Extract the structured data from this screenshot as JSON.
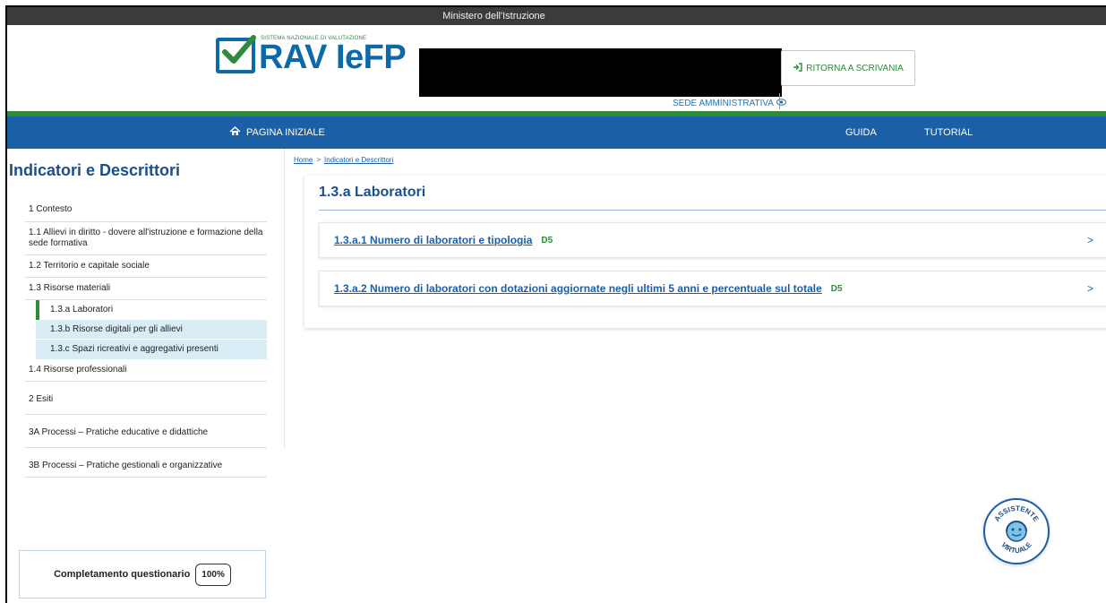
{
  "topbar": {
    "title": "Ministero dell'Istruzione"
  },
  "header": {
    "logo_sub": "SISTEMA NAZIONALE DI VALUTAZIONE",
    "logo_main": "RAV IeFP",
    "sede_label": "SEDE AMMINISTRATIVA",
    "ritorna_label": "RITORNA A SCRIVANIA"
  },
  "nav": {
    "home_label": "PAGINA INIZIALE",
    "guida_label": "GUIDA",
    "tutorial_label": "TUTORIAL"
  },
  "sidebar": {
    "title": "Indicatori e Descrittori",
    "items": [
      {
        "label": "1 Contesto"
      },
      {
        "label": "1.1 Allievi in diritto - dovere all'istruzione e formazione della sede formativa"
      },
      {
        "label": "1.2 Territorio e capitale sociale"
      },
      {
        "label": "1.3 Risorse materiali"
      }
    ],
    "subitems": [
      {
        "label": "1.3.a Laboratori",
        "active": true
      },
      {
        "label": "1.3.b Risorse digitali per gli allievi"
      },
      {
        "label": "1.3.c Spazi ricreativi e aggregativi presenti"
      }
    ],
    "items_after": [
      {
        "label": "1.4 Risorse professionali"
      },
      {
        "label": "2 Esiti"
      },
      {
        "label": "3A Processi – Pratiche educative e didattiche"
      },
      {
        "label": "3B Processi – Pratiche gestionali e organizzative"
      }
    ],
    "completion_label": "Completamento questionario",
    "completion_value": "100%"
  },
  "breadcrumb": {
    "home": "Home",
    "separator": ">",
    "current": "Indicatori e Descrittori"
  },
  "main": {
    "title": "1.3.a Laboratori",
    "cards": [
      {
        "label": "1.3.a.1 Numero di laboratori e tipologia",
        "tag": "D5",
        "chevron": ">"
      },
      {
        "label": "1.3.a.2 Numero di laboratori con dotazioni aggiornate negli ultimi 5 anni e percentuale sul totale",
        "tag": "D5",
        "chevron": ">"
      }
    ]
  },
  "assistant": {
    "top_text": "ASSISTENTE",
    "bottom_text": "VIRTUALE"
  },
  "colors": {
    "primary_blue": "#1b5fa6",
    "accent_green": "#2e8b3c",
    "topbar_gray": "#3b3b3b",
    "submenu_bg": "#d9edf7"
  }
}
